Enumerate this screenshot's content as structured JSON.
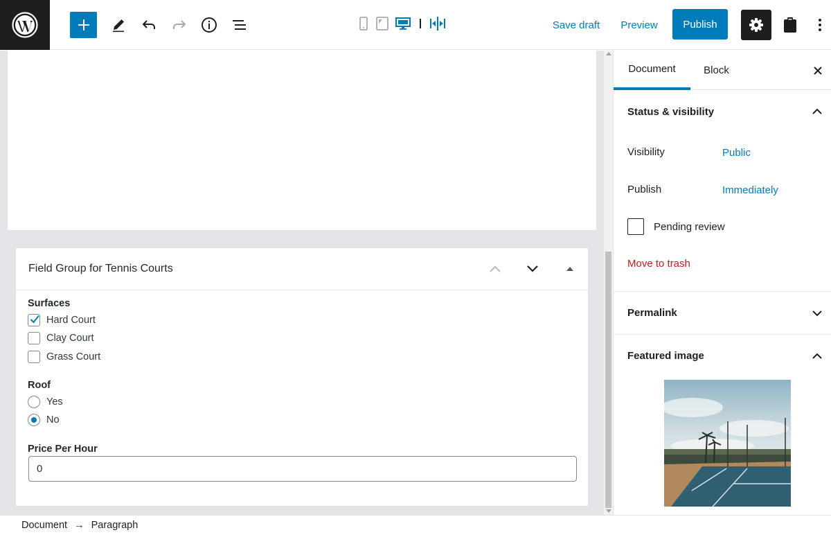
{
  "toolbar": {
    "save_draft_label": "Save draft",
    "preview_label": "Preview",
    "publish_label": "Publish"
  },
  "meta_box": {
    "title": "Field Group for Tennis Courts",
    "fields": {
      "surfaces": {
        "label": "Surfaces",
        "options": [
          {
            "label": "Hard Court",
            "checked": true
          },
          {
            "label": "Clay Court",
            "checked": false
          },
          {
            "label": "Grass Court",
            "checked": false
          }
        ]
      },
      "roof": {
        "label": "Roof",
        "options": [
          {
            "label": "Yes",
            "selected": false
          },
          {
            "label": "No",
            "selected": true
          }
        ]
      },
      "price": {
        "label": "Price Per Hour",
        "value": "0"
      }
    }
  },
  "sidebar": {
    "tabs": [
      {
        "label": "Document",
        "active": true
      },
      {
        "label": "Block",
        "active": false
      }
    ],
    "status_visibility": {
      "title": "Status & visibility",
      "visibility_label": "Visibility",
      "visibility_value": "Public",
      "publish_label": "Publish",
      "publish_value": "Immediately",
      "pending_review_label": "Pending review",
      "move_to_trash_label": "Move to trash"
    },
    "permalink": {
      "title": "Permalink"
    },
    "featured_image": {
      "title": "Featured image"
    }
  },
  "breadcrumb": {
    "items": [
      "Document",
      "Paragraph"
    ],
    "separator": "→"
  },
  "colors": {
    "accent": "#007cba",
    "danger": "#cc1818",
    "dark": "#1e1e1e"
  }
}
